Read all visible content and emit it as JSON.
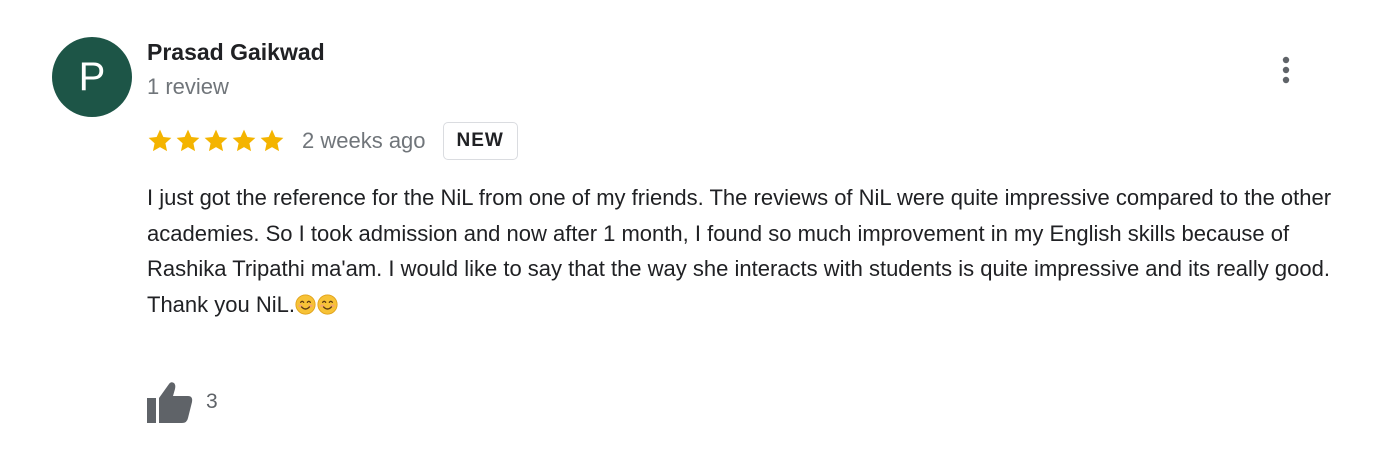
{
  "reviewer": {
    "avatar_initial": "P",
    "avatar_color": "#1d5547",
    "name": "Prasad Gaikwad",
    "review_count": "1 review"
  },
  "review": {
    "rating": 5,
    "max_rating": 5,
    "star_color": "#f4b400",
    "date": "2 weeks ago",
    "badge": "NEW",
    "text_lines": [
      "I just got the reference for the NiL from one of my friends. The reviews of NiL were quite impressive compared to the other academies. So I took admission and now after 1 month, I found so much improvement in my English skills because of Rashika Tripathi ma'am. I would like to say that the way she interacts with students is quite impressive and its really good.",
      "Thank you NiL."
    ],
    "trailing_emoji": [
      "smiling-face-icon",
      "smiling-face-icon"
    ]
  },
  "actions": {
    "more_icon": "more-vert-icon",
    "like_icon": "thumbs-up-icon",
    "like_count": "3"
  }
}
